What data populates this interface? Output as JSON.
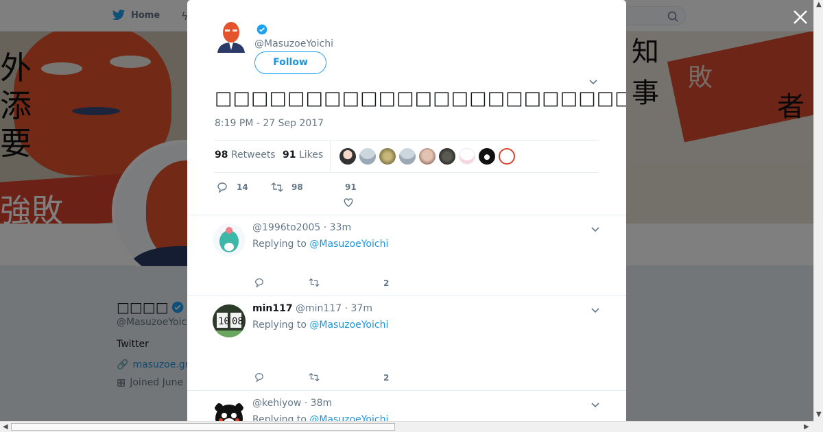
{
  "nav": {
    "home_label": "Home"
  },
  "profile": {
    "name": "□□□□",
    "handle": "@MasuzoeYoichi",
    "bio": "Twitter",
    "link": "masuzoe.gr",
    "joined": "Joined June"
  },
  "tweet": {
    "handle": "@MasuzoeYoichi",
    "follow_label": "Follow",
    "text": "□□□□□□□□□□□□□□□□□□□□□□□□□□□□□□□□□□□□□□□□□□□□□□□□□□□□□",
    "timestamp": "8:19 PM - 27 Sep 2017",
    "retweets_count": "98",
    "retweets_label": "Retweets",
    "likes_count": "91",
    "likes_label": "Likes",
    "actions": {
      "replies": "14",
      "retweets": "98",
      "likes": "91"
    }
  },
  "replies": [
    {
      "name": "",
      "handle": "@1996to2005",
      "time": "33m",
      "replying_prefix": "Replying to",
      "replying_to": "@MasuzoeYoichi",
      "likes": "2"
    },
    {
      "name": "min117",
      "handle": "@min117",
      "time": "37m",
      "replying_prefix": "Replying to",
      "replying_to": "@MasuzoeYoichi",
      "likes": "2"
    },
    {
      "name": "",
      "handle": "@kehiyow",
      "time": "38m",
      "replying_prefix": "Replying to",
      "replying_to": "@MasuzoeYoichi",
      "likes": ""
    }
  ],
  "colors": {
    "accent": "#1da1f2",
    "link": "#1b95e0",
    "muted": "#657786"
  }
}
